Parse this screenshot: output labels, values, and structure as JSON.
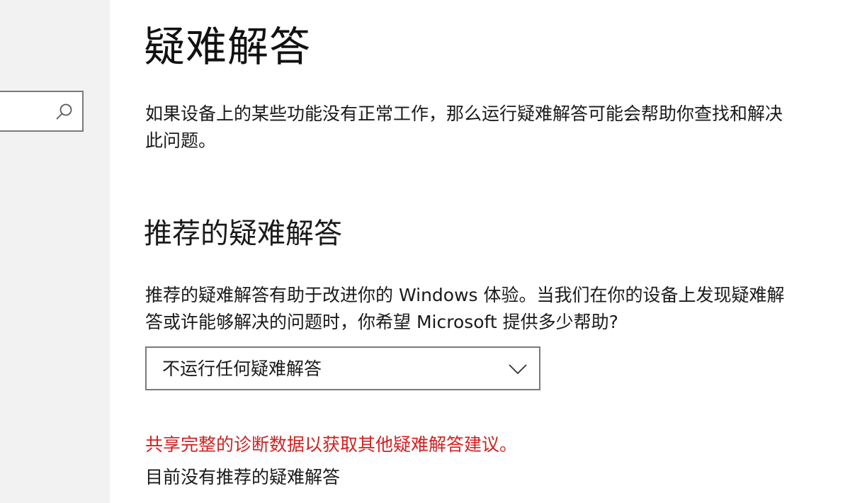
{
  "sidebar": {
    "search": {
      "value": "",
      "icon": "search-icon"
    }
  },
  "main": {
    "title": "疑难解答",
    "intro": "如果设备上的某些功能没有正常工作，那么运行疑难解答可能会帮助你查找和解决此问题。",
    "recommended": {
      "heading": "推荐的疑难解答",
      "description": "推荐的疑难解答有助于改进你的 Windows 体验。当我们在你的设备上发现疑难解答或许能够解决的问题时，你希望 Microsoft 提供多少帮助?",
      "dropdown": {
        "selected": "不运行任何疑难解答",
        "icon": "chevron-down-icon"
      },
      "diagnostic_link": "共享完整的诊断数据以获取其他疑难解答建议。",
      "status": "目前没有推荐的疑难解答"
    }
  },
  "colors": {
    "sidebar_bg": "#f2f2f2",
    "border": "#7a7a7a",
    "link_red": "#d42020",
    "text": "#1a1a1a"
  }
}
